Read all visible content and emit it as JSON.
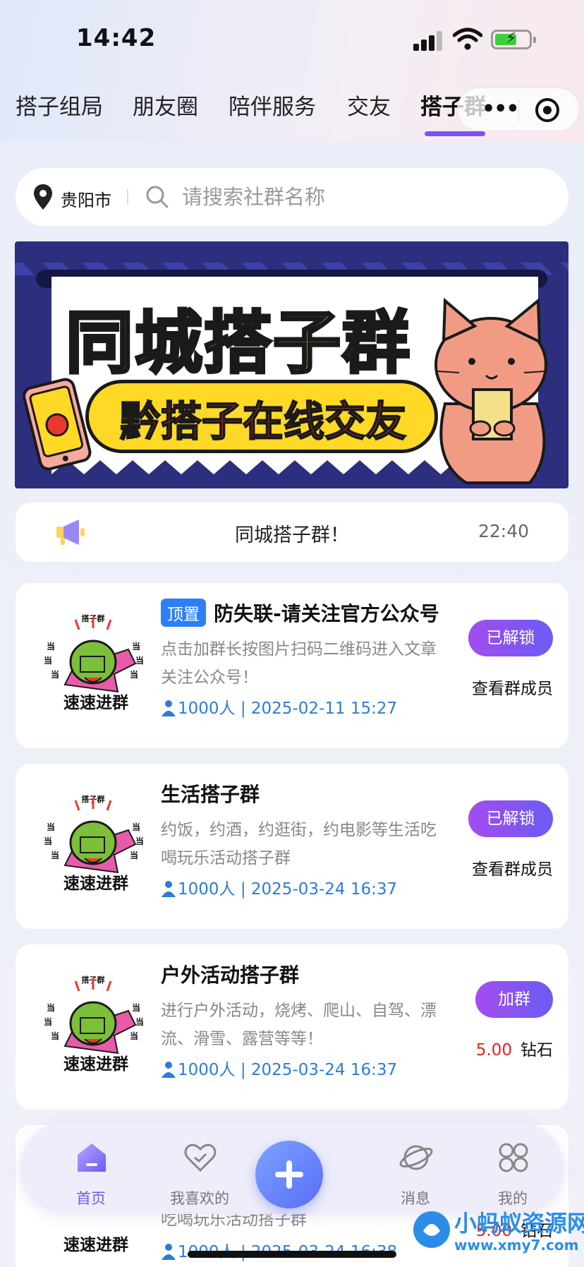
{
  "status_bar": {
    "time": "14:42"
  },
  "tabs": [
    {
      "label": "搭子组局",
      "active": false
    },
    {
      "label": "朋友圈",
      "active": false
    },
    {
      "label": "陪伴服务",
      "active": false
    },
    {
      "label": "交友",
      "active": false
    },
    {
      "label": "搭子群",
      "active": true
    }
  ],
  "search": {
    "city": "贵阳市",
    "placeholder": "请搜索社群名称"
  },
  "banner": {
    "title": "同城搭子群",
    "subtitle": "黔搭子在线交友"
  },
  "notice": {
    "text": "同城搭子群！",
    "time": "22:40"
  },
  "thumb_caption": "速速进群",
  "thumb_tag": "搭子群",
  "groups": [
    {
      "badge": "顶置",
      "title": "防失联-请关注官方公众号",
      "desc": "点击加群长按图片扫码二维码进入文章关注公众号！",
      "meta": "1000人 | 2025-02-11 15:27",
      "button": "已解锁",
      "action": "查看群成员"
    },
    {
      "title": "生活搭子群",
      "desc": "约饭，约酒，约逛街，约电影等生活吃喝玩乐活动搭子群",
      "meta": "1000人 | 2025-03-24 16:37",
      "button": "已解锁",
      "action": "查看群成员"
    },
    {
      "title": "户外活动搭子群",
      "desc": "进行户外活动，烧烤、爬山、自驾、漂流、滑雪、露营等等！",
      "meta": "1000人 | 2025-03-24 16:37",
      "button": "加群",
      "price": "5.00",
      "currency": "钻石"
    },
    {
      "desc_partial": "吃喝玩乐活动搭子群",
      "meta": "1000人 | 2025-03-24 16:38",
      "price": "5.00",
      "currency": "钻石"
    }
  ],
  "bottom_nav": [
    {
      "label": "首页",
      "icon": "home-icon",
      "active": true
    },
    {
      "label": "我喜欢的",
      "icon": "heart-icon",
      "active": false
    },
    {
      "label": "",
      "icon": "plus-icon",
      "active": false
    },
    {
      "label": "消息",
      "icon": "planet-icon",
      "active": false
    },
    {
      "label": "我的",
      "icon": "grid-icon",
      "active": false
    }
  ],
  "watermark": {
    "title": "小蚂蚁资源网",
    "url": "www.xmy7.com"
  },
  "colors": {
    "accent": "#7a55f0",
    "badge_blue": "#2d7ff9",
    "meta_blue": "#2d7cd8",
    "price_red": "#e02424"
  }
}
